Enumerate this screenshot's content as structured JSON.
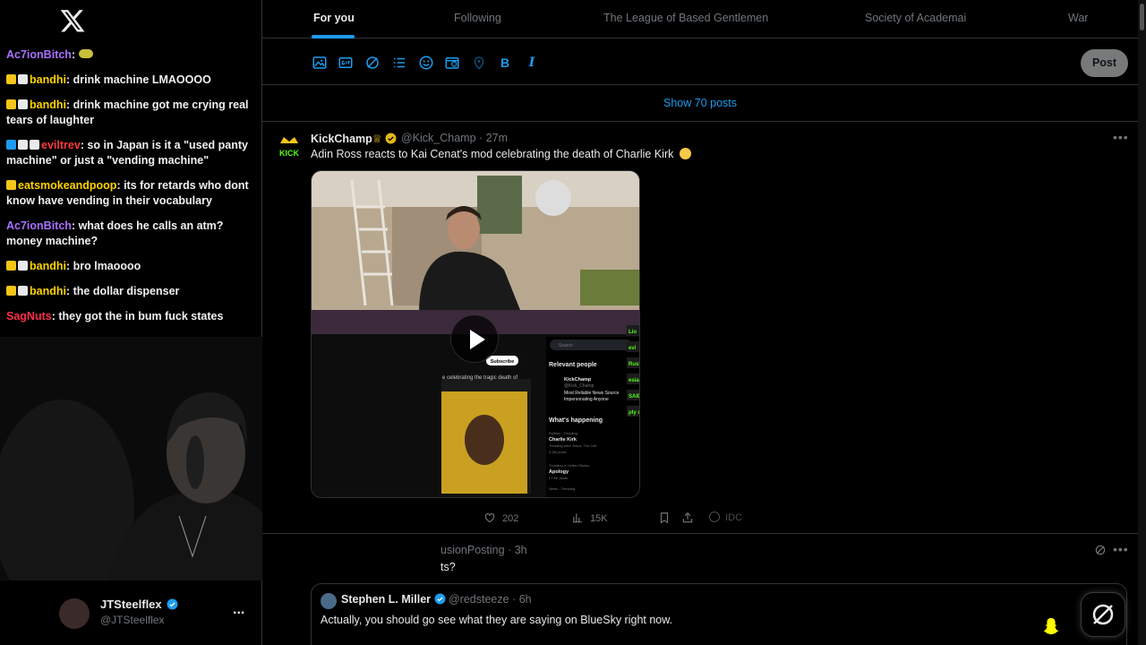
{
  "app": {
    "brand": "X"
  },
  "chat": {
    "messages": [
      {
        "user": "Ac7ionBitch",
        "color": "#a970ff",
        "text": "",
        "badges": [],
        "emote": "ramen-emote"
      },
      {
        "user": "bandhi",
        "color": "#ffd400",
        "text": "drink machine LMAOOOO",
        "badges": [
          "crown",
          "badge"
        ]
      },
      {
        "user": "bandhi",
        "color": "#ffd400",
        "text": "drink machine got me crying real tears of laughter",
        "badges": [
          "crown",
          "badge"
        ]
      },
      {
        "user": "eviltrev",
        "color": "#ff3b3b",
        "text": "so in Japan is it a \"used panty machine\" or just a \"vending machine\"",
        "badges": [
          "verified",
          "badge",
          "badge"
        ]
      },
      {
        "user": "eatsmokeandpoop",
        "color": "#ffd400",
        "text": "its for retards who dont know have vending in their vocabulary",
        "badges": [
          "crown"
        ]
      },
      {
        "user": "Ac7ionBitch",
        "color": "#a970ff",
        "text": "what does he calls an atm? money machine?",
        "badges": []
      },
      {
        "user": "bandhi",
        "color": "#ffd400",
        "text": "bro lmaoooo",
        "badges": [
          "crown",
          "badge"
        ]
      },
      {
        "user": "bandhi",
        "color": "#ffd400",
        "text": "the dollar dispenser",
        "badges": [
          "crown",
          "badge"
        ]
      },
      {
        "user": "SagNuts",
        "color": "#ff2e4d",
        "text": "they got the in bum fuck states",
        "badges": []
      }
    ]
  },
  "account": {
    "name": "JTSteelflex",
    "handle": "@JTSteelflex",
    "more": "..."
  },
  "tabs": [
    {
      "label": "For you",
      "active": true
    },
    {
      "label": "Following",
      "active": false
    },
    {
      "label": "The League of Based Gentlemen",
      "active": false
    },
    {
      "label": "Society of Academai",
      "active": false
    },
    {
      "label": "War",
      "active": false
    }
  ],
  "composer": {
    "post_label": "Post",
    "tools": [
      "image-icon",
      "gif-icon",
      "grok-icon",
      "poll-icon",
      "emoji-icon",
      "schedule-icon",
      "location-icon",
      "bold-icon",
      "italic-icon"
    ],
    "bold_glyph": "B",
    "italic_glyph": "I"
  },
  "feed": {
    "show_posts": "Show 70 posts",
    "tweet1": {
      "name": "KickChamp",
      "handle": "@Kick_Champ",
      "time": "27m",
      "text": "Adin Ross reacts to Kai Cenat's mod celebrating the death of Charlie Kirk",
      "avatar_text": "KICK",
      "video_overlay": {
        "subscribe": "Subscribe",
        "caption": "e celebrating the tragic death of",
        "search": "Search",
        "relevant_people": "Relevant people",
        "rp_name": "KickChamp",
        "rp_handle": "@Kick_Champ",
        "rp_bio": "Most Reliable News Source",
        "rp_bio2": "Impersonating Anyone",
        "whats_happening": "What's happening",
        "trend1_cat": "Politics · Trending",
        "trend1": "Charlie Kirk",
        "trend1_sub": "Trending with: Jesus, The Left",
        "trend1_posts": "3.2M posts",
        "trend2_cat": "Trending in United States",
        "trend2": "Apology",
        "trend2_posts": "27.6K posts",
        "trend3_cat": "News · Trending",
        "right_labels": [
          "Lio",
          "evi",
          "Rust",
          "esia",
          "SAID",
          "ply d"
        ]
      },
      "likes": "202",
      "views": "15K",
      "idc": "IDC"
    },
    "tweet2": {
      "name": "usionPosting",
      "time": "3h",
      "text": "ts?",
      "quote": {
        "name": "Stephen L. Miller",
        "handle": "@redsteeze",
        "time": "6h",
        "text": "Actually, you should go see what they are saying on BlueSky right now."
      }
    }
  },
  "colors": {
    "accent": "#1d9bf0",
    "background": "#000000",
    "border": "#2f3336",
    "muted": "#71767b"
  }
}
